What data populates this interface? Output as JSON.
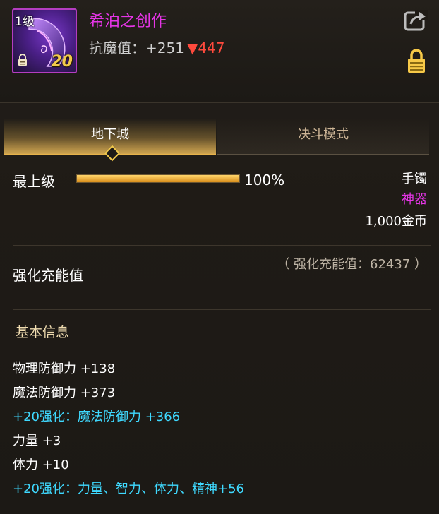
{
  "item": {
    "level_badge": "1级",
    "enhancement": "20",
    "name": "希泊之创作",
    "stat_label": "抗魔值：+251",
    "stat_delta": "▼447",
    "colors": {
      "name": "#e535e6",
      "frame": "#b43dc0",
      "delta": "#ff4a3d"
    }
  },
  "icons": {
    "share": "share-icon",
    "lock": "lock-icon",
    "item_lock": "lock-icon"
  },
  "tabs": [
    {
      "label": "地下城",
      "active": true
    },
    {
      "label": "决斗模式",
      "active": false
    }
  ],
  "level": {
    "label": "最上级",
    "progress": 1.0,
    "percent_text": "100%"
  },
  "meta": {
    "type": "手镯",
    "grade": "神器",
    "price": "1,000金币"
  },
  "charge": {
    "title": "强化充能值",
    "value_text": "（ 强化充能值：62437 ）"
  },
  "basic_info": {
    "title": "基本信息",
    "stats": [
      {
        "text": "物理防御力 +138",
        "color": "white"
      },
      {
        "text": "魔法防御力 +373",
        "color": "white"
      },
      {
        "text": "+20强化：魔法防御力 +366",
        "color": "cyan"
      },
      {
        "text": "力量 +3",
        "color": "white"
      },
      {
        "text": "体力 +10",
        "color": "white"
      },
      {
        "text": "+20强化：力量、智力、体力、精神+56",
        "color": "cyan"
      }
    ]
  }
}
